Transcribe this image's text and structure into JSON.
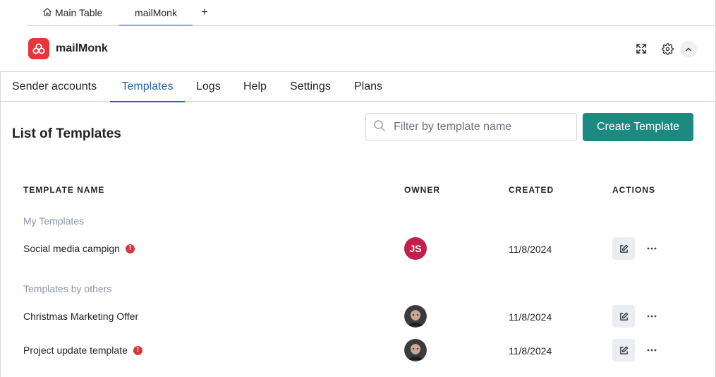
{
  "board_tabs": {
    "main_table": "Main Table",
    "mailmonk": "mailMonk",
    "add": "+"
  },
  "app": {
    "title": "mailMonk",
    "logo_color": "#e8343b"
  },
  "nav": {
    "items": [
      "Sender accounts",
      "Templates",
      "Logs",
      "Help",
      "Settings",
      "Plans"
    ],
    "active": "Templates"
  },
  "page": {
    "title": "List of Templates",
    "search_placeholder": "Filter by template name",
    "create_button": "Create Template"
  },
  "table": {
    "headers": {
      "name": "TEMPLATE NAME",
      "owner": "OWNER",
      "created": "CREATED",
      "actions": "ACTIONS"
    },
    "groups": [
      {
        "label": "My Templates",
        "rows": [
          {
            "name": "Social media campign",
            "warning": true,
            "owner_initials": "JS",
            "created": "11/8/2024"
          }
        ]
      },
      {
        "label": "Templates by others",
        "rows": [
          {
            "name": "Christmas Marketing Offer",
            "warning": false,
            "owner_initials": "",
            "created": "11/8/2024"
          },
          {
            "name": "Project update template",
            "warning": true,
            "owner_initials": "",
            "created": "11/8/2024"
          }
        ]
      }
    ]
  },
  "colors": {
    "accent_button": "#1c8a80",
    "active_tab": "#2a64b8",
    "warning": "#d0393e",
    "avatar_js": "#c41e4a"
  },
  "icons": {
    "home": "home-icon",
    "search": "search-icon",
    "expand": "expand-icon",
    "settings": "gear-icon",
    "collapse": "chevron-up-icon",
    "edit": "edit-icon",
    "more": "more-horizontal-icon",
    "warning": "warning-icon"
  }
}
